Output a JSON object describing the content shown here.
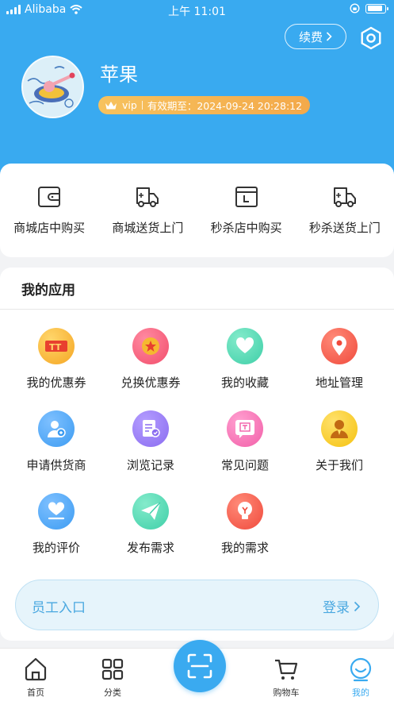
{
  "status_bar": {
    "carrier": "Alibaba",
    "time": "上午 11:01"
  },
  "header": {
    "renew_label": "续费",
    "username": "苹果",
    "vip_label": "vip",
    "vip_expiry": "有效期至：2024-09-24 20:28:12",
    "colors": {
      "brand": "#39aaf0",
      "vip_gold": "#f5b450"
    }
  },
  "shortcuts": [
    {
      "label": "商城店中购买",
      "icon": "wallet-icon"
    },
    {
      "label": "商城送货上门",
      "icon": "delivery-truck-icon"
    },
    {
      "label": "秒杀店中购买",
      "icon": "package-box-icon"
    },
    {
      "label": "秒杀送货上门",
      "icon": "delivery-truck-icon"
    }
  ],
  "apps": {
    "title": "我的应用",
    "items": [
      {
        "label": "我的优惠券",
        "icon": "coupon-icon",
        "color": "#f5a623"
      },
      {
        "label": "兑换优惠券",
        "icon": "exchange-coupon-icon",
        "color": "#f24d6b"
      },
      {
        "label": "我的收藏",
        "icon": "heart-icon",
        "color": "#3fcfa8"
      },
      {
        "label": "地址管理",
        "icon": "location-pin-icon",
        "color": "#f04a3c"
      },
      {
        "label": "申请供货商",
        "icon": "supplier-icon",
        "color": "#3d9cf2"
      },
      {
        "label": "浏览记录",
        "icon": "history-icon",
        "color": "#8a6cf0"
      },
      {
        "label": "常见问题",
        "icon": "faq-icon",
        "color": "#f25fa8"
      },
      {
        "label": "关于我们",
        "icon": "about-us-icon",
        "color": "#f5c20f"
      },
      {
        "label": "我的评价",
        "icon": "review-heart-icon",
        "color": "#3d9cf2"
      },
      {
        "label": "发布需求",
        "icon": "paper-plane-icon",
        "color": "#3fcfa8"
      },
      {
        "label": "我的需求",
        "icon": "lightbulb-icon",
        "color": "#f04a3c"
      }
    ]
  },
  "staff": {
    "label": "员工入口",
    "login": "登录"
  },
  "tabbar": [
    {
      "label": "首页",
      "icon": "home-icon"
    },
    {
      "label": "分类",
      "icon": "category-grid-icon"
    },
    {
      "label": "",
      "icon": "scan-icon"
    },
    {
      "label": "购物车",
      "icon": "cart-icon"
    },
    {
      "label": "我的",
      "icon": "profile-smile-icon",
      "active": true
    }
  ]
}
